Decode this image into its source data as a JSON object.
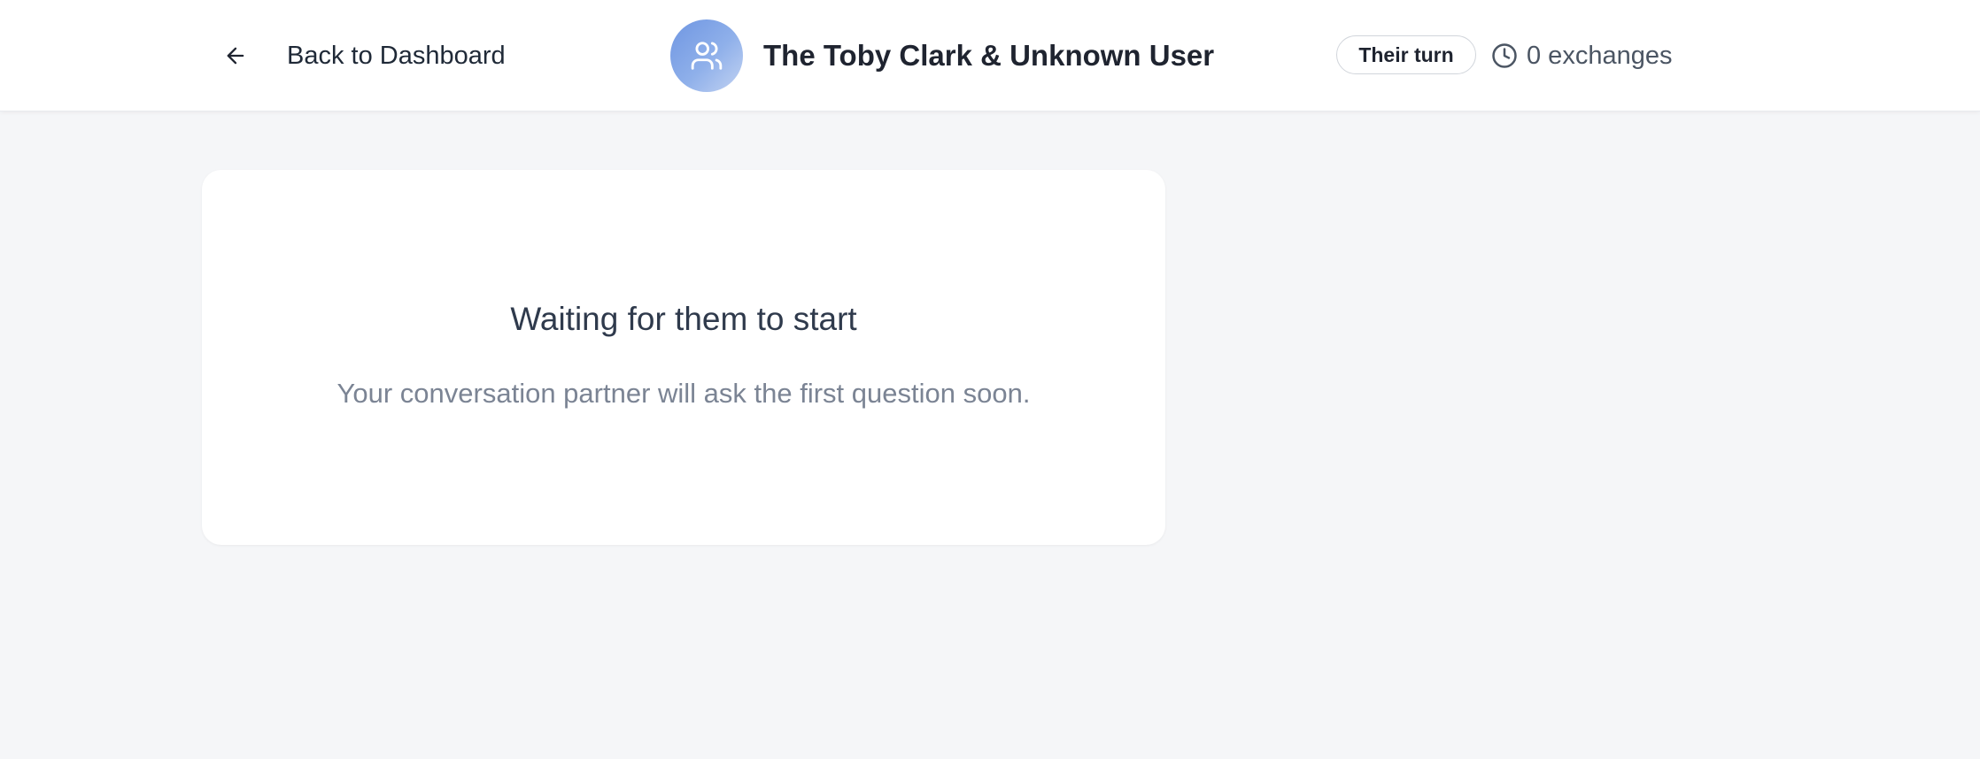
{
  "header": {
    "back_label": "Back to Dashboard",
    "back_icon": "arrow-left-icon",
    "avatar_icon": "users-icon",
    "title": "The Toby Clark & Unknown User",
    "turn_badge": "Their turn",
    "exchanges_icon": "clock-icon",
    "exchanges_label": "0 exchanges"
  },
  "main": {
    "status_title": "Waiting for them to start",
    "status_message": "Your conversation partner will ask the first question soon."
  },
  "colors": {
    "background": "#f5f6f8",
    "surface": "#ffffff",
    "avatar_gradient_start": "#6f96e2",
    "avatar_gradient_end": "#c3d3f2",
    "muted_text": "#7b8494"
  }
}
